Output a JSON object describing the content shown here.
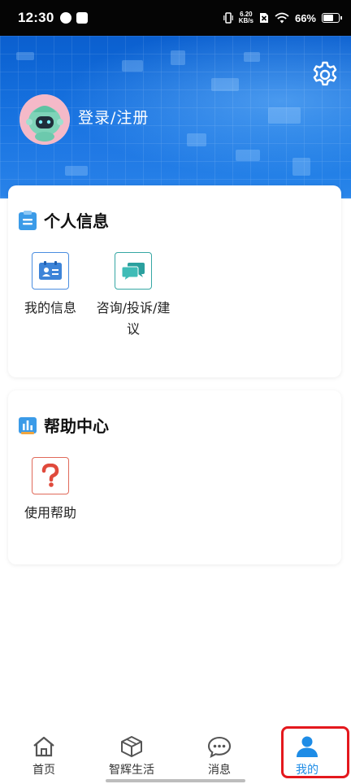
{
  "status_bar": {
    "time": "12:30",
    "net_speed_value": "6.20",
    "net_speed_unit": "KB/s",
    "battery": "66%"
  },
  "header": {
    "login_label": "登录/注册",
    "settings_icon": "gear-icon",
    "accent_color": "#1473e0"
  },
  "personal_info": {
    "title": "个人信息",
    "items": [
      {
        "label": "我的信息",
        "icon": "id-card-icon"
      },
      {
        "label_line1": "咨询/投诉/建",
        "label_line2": "议",
        "icon": "chat-bubbles-icon"
      }
    ]
  },
  "help_center": {
    "title": "帮助中心",
    "items": [
      {
        "label": "使用帮助",
        "icon": "question-mark-icon"
      }
    ]
  },
  "bottom_nav": {
    "items": [
      {
        "label": "首页",
        "icon": "home-icon"
      },
      {
        "label": "智辉生活",
        "icon": "box-icon"
      },
      {
        "label": "消息",
        "icon": "message-icon"
      },
      {
        "label": "我的",
        "icon": "user-icon",
        "active": true
      }
    ],
    "active_color": "#1e8ce6",
    "highlight_color": "#e4181d"
  }
}
